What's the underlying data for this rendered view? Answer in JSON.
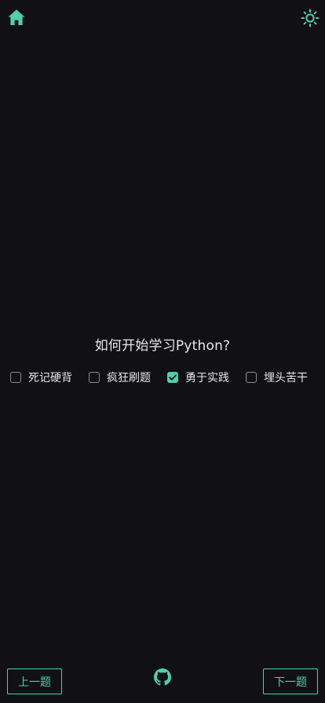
{
  "colors": {
    "background": "#111114",
    "accent": "#4fd1a5",
    "text": "#e6e6e6",
    "checkbox_border": "#8a8a8a"
  },
  "header": {
    "home_icon": "home-icon",
    "theme_icon": "sun-icon"
  },
  "quiz": {
    "question": "如何开始学习Python?",
    "options": [
      {
        "label": "死记硬背",
        "checked": false
      },
      {
        "label": "疯狂刷题",
        "checked": false
      },
      {
        "label": "勇于实践",
        "checked": true
      },
      {
        "label": "埋头苦干",
        "checked": false
      }
    ]
  },
  "footer": {
    "prev_label": "上一题",
    "next_label": "下一题",
    "github_icon": "github-icon"
  }
}
